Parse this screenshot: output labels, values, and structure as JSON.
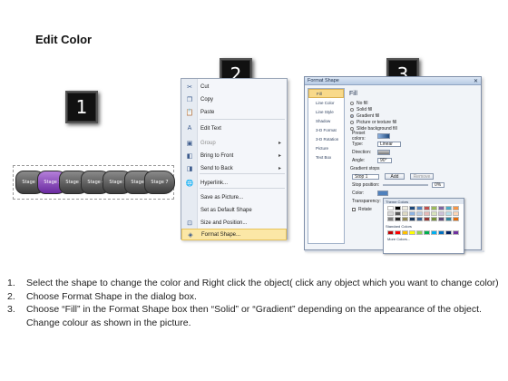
{
  "title": "Edit Color",
  "badges": [
    "1",
    "2",
    "3"
  ],
  "stages": [
    "Stage 1",
    "Stage 2",
    "Stage 3",
    "Stage 4",
    "Stage 5",
    "Stage 6",
    "Stage 7"
  ],
  "selected_stage_color": "#7b35b5",
  "context_menu": {
    "items": [
      {
        "label": "Cut",
        "icon": "scissors-icon",
        "glyph": "✂",
        "disabled": false,
        "submenu": false
      },
      {
        "label": "Copy",
        "icon": "copy-icon",
        "glyph": "❐",
        "disabled": false,
        "submenu": false
      },
      {
        "label": "Paste",
        "icon": "paste-icon",
        "glyph": "📋",
        "disabled": false,
        "submenu": false
      },
      {
        "label": "Edit Text",
        "icon": "edit-text-icon",
        "glyph": "A",
        "disabled": false,
        "submenu": false
      },
      {
        "label": "Group",
        "icon": "group-icon",
        "glyph": "▣",
        "disabled": true,
        "submenu": true
      },
      {
        "label": "Bring to Front",
        "icon": "bring-front-icon",
        "glyph": "◧",
        "disabled": false,
        "submenu": true
      },
      {
        "label": "Send to Back",
        "icon": "send-back-icon",
        "glyph": "◨",
        "disabled": false,
        "submenu": true
      },
      {
        "label": "Hyperlink...",
        "icon": "hyperlink-icon",
        "glyph": "🌐",
        "disabled": false,
        "submenu": false
      },
      {
        "label": "Save as Picture...",
        "icon": "",
        "glyph": "",
        "disabled": false,
        "submenu": false
      },
      {
        "label": "Set as Default Shape",
        "icon": "",
        "glyph": "",
        "disabled": false,
        "submenu": false
      },
      {
        "label": "Size and Position...",
        "icon": "size-icon",
        "glyph": "⊡",
        "disabled": false,
        "submenu": false
      },
      {
        "label": "Format Shape...",
        "icon": "format-shape-icon",
        "glyph": "◈",
        "disabled": false,
        "submenu": false,
        "highlighted": true
      }
    ]
  },
  "dialog": {
    "title": "Format Shape",
    "close": "✕",
    "categories": [
      "Fill",
      "Line Color",
      "Line Style",
      "Shadow",
      "3-D Format",
      "3-D Rotation",
      "Picture",
      "Text Box"
    ],
    "selected_category": "Fill",
    "heading": "Fill",
    "fill_options": [
      {
        "label": "No fill",
        "on": false
      },
      {
        "label": "Solid fill",
        "on": false
      },
      {
        "label": "Gradient fill",
        "on": true
      },
      {
        "label": "Picture or texture fill",
        "on": false
      },
      {
        "label": "Slide background fill",
        "on": false
      }
    ],
    "preset_colors_label": "Preset colors:",
    "type_label": "Type:",
    "type_value": "Linear",
    "direction_label": "Direction:",
    "angle_label": "Angle:",
    "angle_value": "90°",
    "gradient_stops_label": "Gradient stops",
    "stop_value": "Stop 1",
    "add_label": "Add",
    "remove_label": "Remove",
    "stop_position_label": "Stop position:",
    "stop_position_value": "0%",
    "color_label": "Color:",
    "transparency_label": "Transparency:",
    "rotate_label": "Rotate"
  },
  "palette": {
    "theme_label": "Theme Colors",
    "standard_label": "Standard Colors",
    "more_label": "More Colors...",
    "theme_top": [
      "#ffffff",
      "#000000",
      "#eeece1",
      "#1f497d",
      "#4f81bd",
      "#c0504d",
      "#9bbb59",
      "#8064a2",
      "#4bacc6",
      "#f79646"
    ],
    "theme_shades": [
      "#d8d8d8",
      "#595959",
      "#ddd9c3",
      "#8db3e2",
      "#b8cce4",
      "#e5b9b7",
      "#d7e3bc",
      "#ccc1d9",
      "#b7dde8",
      "#fbd5b5"
    ],
    "theme_dark": [
      "#7f7f7f",
      "#262626",
      "#948a54",
      "#17365d",
      "#366092",
      "#953734",
      "#76923c",
      "#5f497a",
      "#31859b",
      "#e36c09"
    ],
    "standard": [
      "#c00000",
      "#ff0000",
      "#ffc000",
      "#ffff00",
      "#92d050",
      "#00b050",
      "#00b0f0",
      "#0070c0",
      "#002060",
      "#7030a0"
    ]
  },
  "instructions": [
    {
      "n": "1.",
      "text": "Select the shape to change the color and Right click the object( click any object which you want to change color)"
    },
    {
      "n": "2.",
      "text": "Choose Format Shape in the dialog box."
    },
    {
      "n": "3.",
      "text": "Choose “Fill” in the Format Shape box then “Solid” or “Gradient” depending on the appearance of the object. Change colour as shown in the picture."
    }
  ]
}
